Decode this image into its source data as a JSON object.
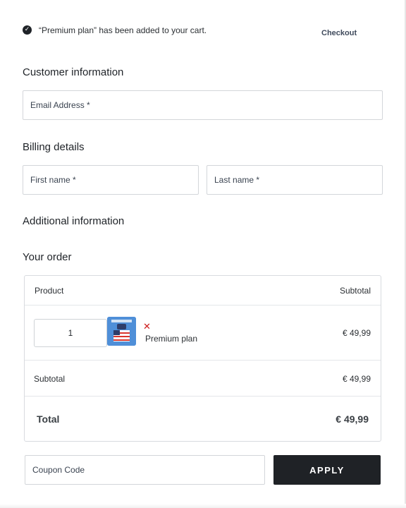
{
  "notice": {
    "icon": "check-circle-icon",
    "message": "“Premium plan” has been added to your cart.",
    "checkout_link": "Checkout"
  },
  "customer_information": {
    "heading": "Customer information",
    "email_placeholder": "Email Address *"
  },
  "billing_details": {
    "heading": "Billing details",
    "first_name_placeholder": "First name *",
    "last_name_placeholder": "Last name *"
  },
  "additional_information": {
    "heading": "Additional information"
  },
  "order": {
    "heading": "Your order",
    "columns": {
      "product": "Product",
      "subtotal": "Subtotal"
    },
    "items": [
      {
        "quantity": "1",
        "thumbnail_icon": "product-thumbnail-icon",
        "remove_icon": "remove-x-icon",
        "name": "Premium plan",
        "price": "€ 49,99"
      }
    ],
    "subtotal_label": "Subtotal",
    "subtotal_value": "€ 49,99",
    "total_label": "Total",
    "total_value": "€ 49,99"
  },
  "coupon": {
    "placeholder": "Coupon Code",
    "apply_label": "APPLY"
  },
  "colors": {
    "apply_button_bg": "#1f2226",
    "remove_icon": "#cc1a1a",
    "thumbnail_bg": "#4f8fd8"
  }
}
